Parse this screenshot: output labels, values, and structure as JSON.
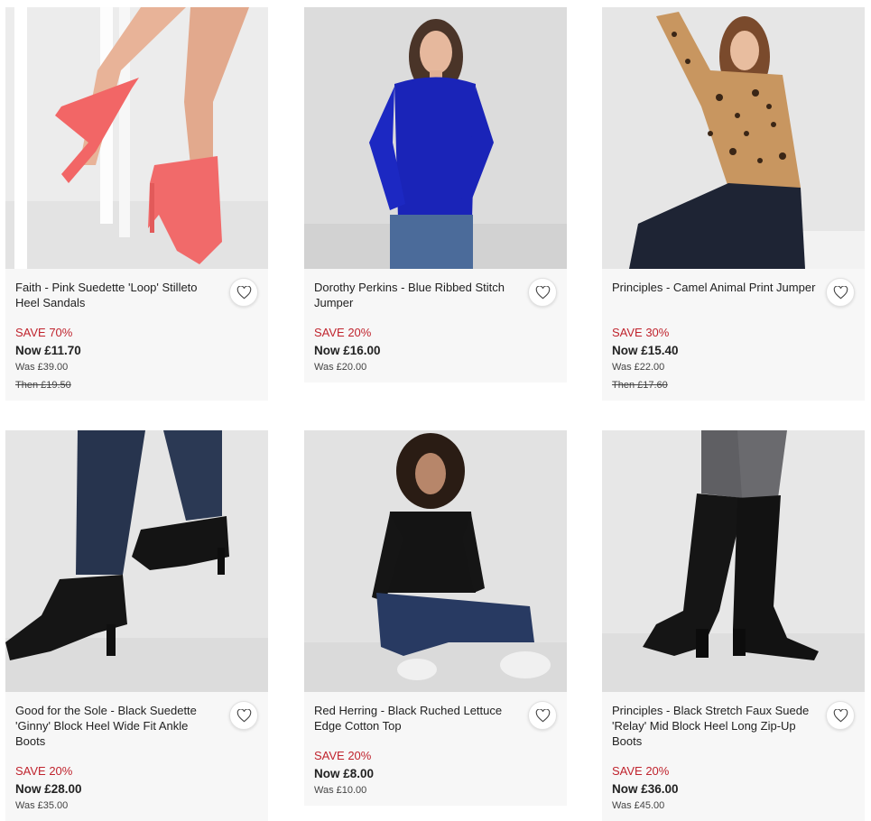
{
  "products": [
    {
      "title": "Faith - Pink Suedette 'Loop' Stilleto Heel Sandals",
      "save": "SAVE 70%",
      "now": "Now £11.70",
      "was": "Was £39.00",
      "then": "Then £19.50",
      "image": "pink-heel-sandals-photo"
    },
    {
      "title": "Dorothy Perkins - Blue Ribbed Stitch Jumper",
      "save": "SAVE 20%",
      "now": "Now £16.00",
      "was": "Was £20.00",
      "image": "blue-jumper-photo"
    },
    {
      "title": "Principles - Camel Animal Print Jumper",
      "save": "SAVE 30%",
      "now": "Now £15.40",
      "was": "Was £22.00",
      "then": "Then £17.60",
      "image": "animal-print-jumper-photo"
    },
    {
      "title": "Good for the Sole - Black Suedette 'Ginny' Block Heel Wide Fit Ankle Boots",
      "save": "SAVE 20%",
      "now": "Now £28.00",
      "was": "Was £35.00",
      "image": "black-ankle-boots-photo"
    },
    {
      "title": "Red Herring - Black Ruched Lettuce Edge Cotton Top",
      "save": "SAVE 20%",
      "now": "Now £8.00",
      "was": "Was £10.00",
      "image": "black-cotton-top-photo"
    },
    {
      "title": "Principles - Black Stretch Faux Suede 'Relay' Mid Block Heel Long Zip-Up Boots",
      "save": "SAVE 20%",
      "now": "Now £36.00",
      "was": "Was £45.00",
      "image": "black-long-boots-photo"
    }
  ],
  "colors": {
    "save_red": "#c0242e",
    "card_bg": "#f7f7f7"
  },
  "icons": {
    "wishlist": "heart-icon"
  }
}
